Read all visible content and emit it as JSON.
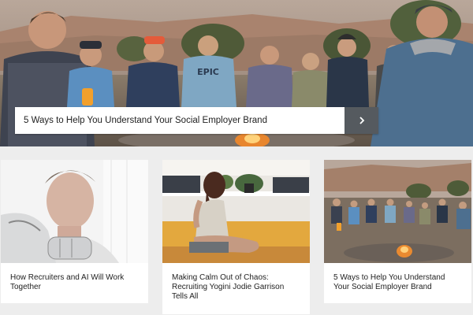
{
  "hero": {
    "title": "5 Ways to Help You Understand Your Social Employer Brand",
    "arrow_icon": "chevron-right-icon",
    "shirt_text": "EPIC"
  },
  "cards": [
    {
      "title": "How Recruiters and AI Will Work Together",
      "image": "man-with-robot-arm-photo"
    },
    {
      "title": "Making Calm Out of Chaos: Recruiting Yogini Jodie Garrison Tells All",
      "image": "yoga-woman-photo"
    },
    {
      "title": "5 Ways to Help You Understand Your Social Employer Brand",
      "image": "campfire-group-photo"
    }
  ],
  "colors": {
    "page_bg": "#ededed",
    "card_bg": "#ffffff",
    "arrow_bg": "#555a5f"
  }
}
